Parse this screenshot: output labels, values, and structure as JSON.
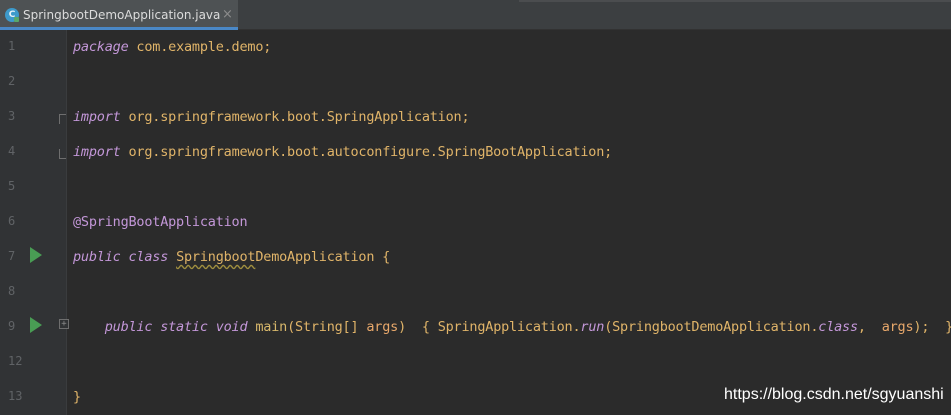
{
  "tab": {
    "icon_letter": "C",
    "filename": "SpringbootDemoApplication.java",
    "close_glyph": "×"
  },
  "code_lines": [
    {
      "number": "1",
      "tokens": [
        {
          "t": "package",
          "c": "kw2"
        },
        {
          "t": " com.example.demo;",
          "c": "pkg"
        }
      ]
    },
    {
      "number": "2",
      "tokens": []
    },
    {
      "number": "3",
      "tokens": [
        {
          "t": "import",
          "c": "kw2"
        },
        {
          "t": " org.springframework.boot.SpringApplication;",
          "c": "pkg"
        }
      ]
    },
    {
      "number": "4",
      "tokens": [
        {
          "t": "import",
          "c": "kw2"
        },
        {
          "t": " org.springframework.boot.autoconfigure.SpringBootApplication;",
          "c": "pkg"
        }
      ]
    },
    {
      "number": "5",
      "tokens": []
    },
    {
      "number": "6",
      "tokens": [
        {
          "t": "@SpringBootApplication",
          "c": "anno"
        }
      ]
    },
    {
      "number": "7",
      "tokens": [
        {
          "t": "public class ",
          "c": "kw2"
        },
        {
          "t": "Springboot",
          "c": "cls squiggle"
        },
        {
          "t": "DemoApplication {",
          "c": "cls"
        }
      ]
    },
    {
      "number": "8",
      "tokens": []
    },
    {
      "number": "9",
      "tokens": [
        {
          "t": "    public static void ",
          "c": "kw2"
        },
        {
          "t": "main",
          "c": "fn"
        },
        {
          "t": "(String[] ",
          "c": "paren"
        },
        {
          "t": "args",
          "c": "param"
        },
        {
          "t": ")  { SpringApplication.",
          "c": "paren"
        },
        {
          "t": "run",
          "c": "kw2"
        },
        {
          "t": "(SpringbootDemoApplication.",
          "c": "paren"
        },
        {
          "t": "class",
          "c": "kw2"
        },
        {
          "t": ",  ",
          "c": "paren"
        },
        {
          "t": "args",
          "c": "param"
        },
        {
          "t": ");  }",
          "c": "paren"
        }
      ]
    },
    {
      "number": "12",
      "tokens": []
    },
    {
      "number": "13",
      "tokens": [
        {
          "t": "}",
          "c": "paren"
        }
      ]
    }
  ],
  "gutter_markers": {
    "run_lines": [
      "7",
      "9"
    ],
    "fold_lines": [
      "9"
    ]
  },
  "watermark": "https://blog.csdn.net/sgyuanshi",
  "colors": {
    "background": "#2b2b2b",
    "gutter": "#313335",
    "tab_active": "#4e5254",
    "tab_underline": "#4a88c7",
    "run_icon": "#499c54",
    "keyword": "#c397d8",
    "identifier": "#e0b469"
  }
}
